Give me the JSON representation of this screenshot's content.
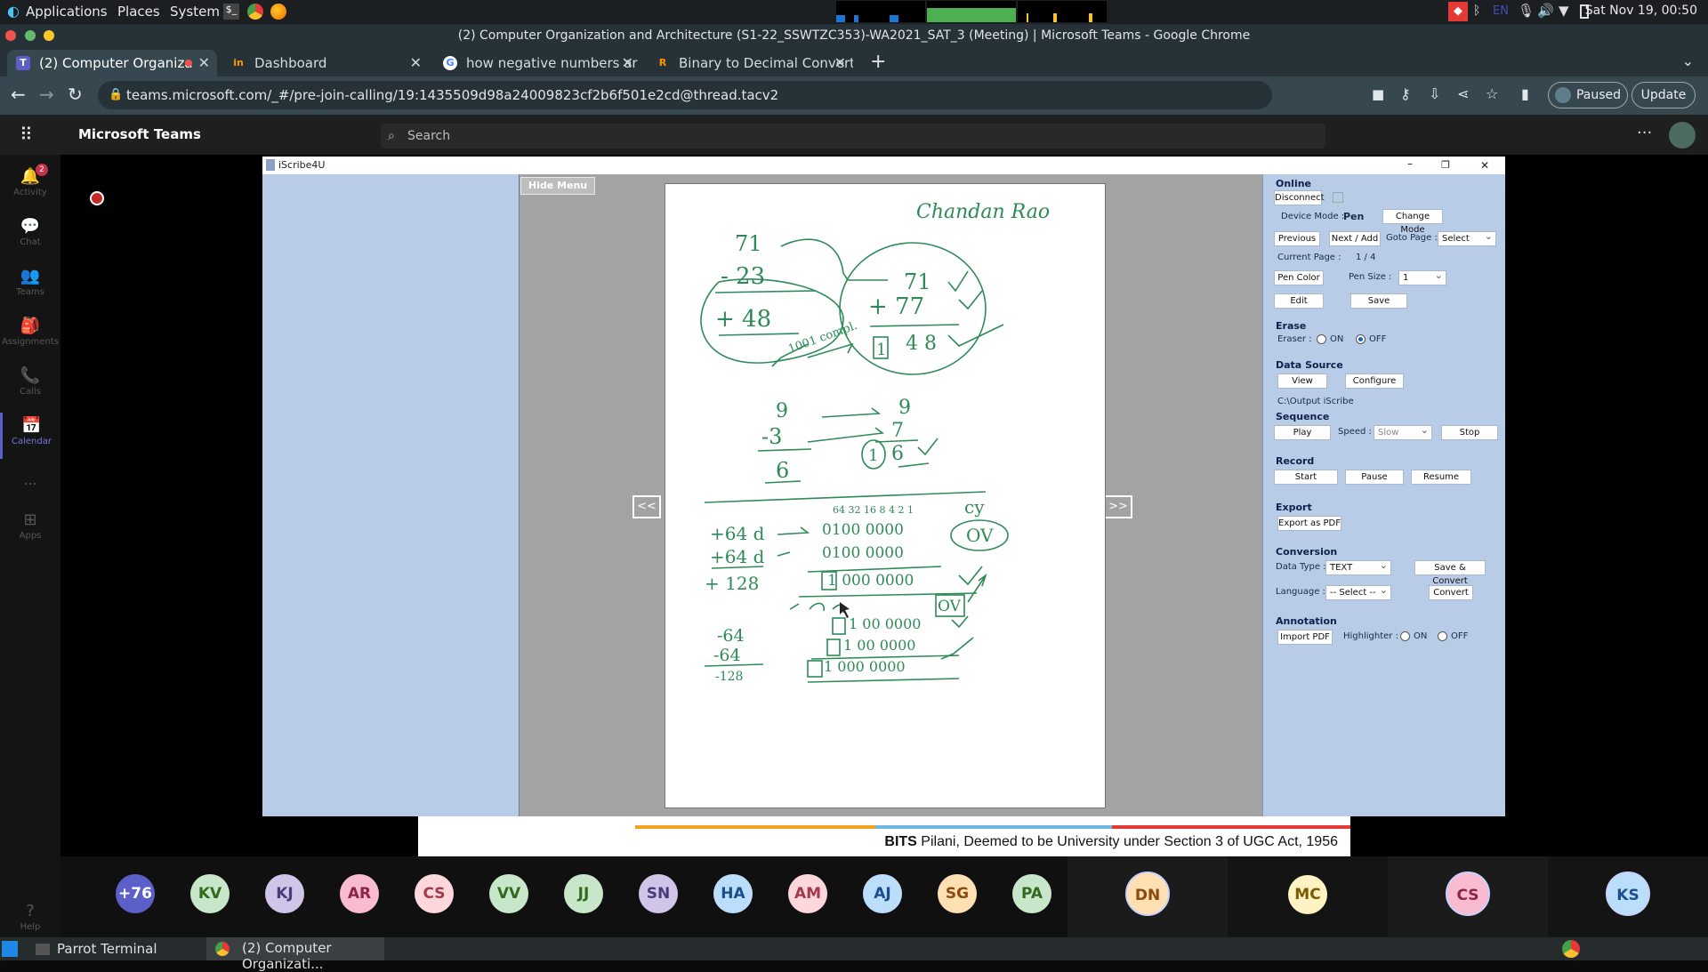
{
  "system_bar": {
    "menus": [
      "Applications",
      "Places",
      "System"
    ],
    "language": "EN",
    "clock": "Sat Nov 19, 00:50"
  },
  "window_title": "(2) Computer Organization and Architecture (S1-22_SSWTZC353)-WA2021_SAT_3 (Meeting) | Microsoft Teams - Google Chrome",
  "tabs": [
    {
      "label": "(2) Computer Organiza",
      "icon": "teams-icon"
    },
    {
      "label": "Dashboard",
      "icon": "dashboard-icon"
    },
    {
      "label": "how negative numbers ar",
      "icon": "google-icon"
    },
    {
      "label": "Binary to Decimal Convert",
      "icon": "rapidtables-icon"
    }
  ],
  "address_bar": {
    "url": "teams.microsoft.com/_#/pre-join-calling/19:1435509d98a24009823cf2b6f501e2cd@thread.tacv2",
    "profile_label": "Paused",
    "update_label": "Update"
  },
  "teams": {
    "brand": "Microsoft Teams",
    "search_placeholder": "Search",
    "rail": [
      {
        "label": "Activity",
        "icon": "bell-icon",
        "badge": "2"
      },
      {
        "label": "Chat",
        "icon": "chat-icon"
      },
      {
        "label": "Teams",
        "icon": "teams-icon"
      },
      {
        "label": "Assignments",
        "icon": "assignments-icon"
      },
      {
        "label": "Calls",
        "icon": "phone-icon"
      },
      {
        "label": "Calendar",
        "icon": "calendar-icon"
      },
      {
        "label": "...",
        "icon": "more-icon"
      },
      {
        "label": "Apps",
        "icon": "apps-icon"
      },
      {
        "label": "Help",
        "icon": "help-icon"
      }
    ]
  },
  "iscribe": {
    "title": "iScribe4U",
    "hide_menu": "Hide Menu",
    "prev_page": "<<",
    "next_page": ">>",
    "panel": {
      "online": "Online",
      "disconnect": "Disconnect",
      "device_mode_label": "Device Mode :",
      "device_mode_value": "Pen",
      "change_mode": "Change Mode",
      "previous": "Previous",
      "next_add": "Next / Add",
      "goto_page_label": "Goto Page :",
      "goto_page_value": "Select",
      "current_page_label": "Current Page :",
      "current_page_value": "1 / 4",
      "pen_color": "Pen Color",
      "pen_size_label": "Pen Size :",
      "pen_size_value": "1",
      "edit": "Edit",
      "save": "Save",
      "erase": "Erase",
      "eraser_label": "Eraser :",
      "eraser_on": "ON",
      "eraser_off": "OFF",
      "data_source": "Data Source",
      "view": "View",
      "configure": "Configure",
      "output_path": "C:\\Output iScribe",
      "sequence": "Sequence",
      "play": "Play",
      "speed_label": "Speed :",
      "speed_value": "Slow",
      "stop": "Stop",
      "record": "Record",
      "start": "Start",
      "pause": "Pause",
      "resume": "Resume",
      "export": "Export",
      "export_pdf": "Export as PDF",
      "conversion": "Conversion",
      "data_type_label": "Data Type :",
      "data_type_value": "TEXT",
      "save_convert": "Save & Convert",
      "language_label": "Language :",
      "language_value": "-- Select --",
      "convert": "Convert",
      "annotation": "Annotation",
      "import_pdf": "Import PDF",
      "highlighter_label": "Highlighter :",
      "highlighter_on": "ON",
      "highlighter_off": "OFF"
    },
    "handwriting": {
      "title": "Chandan Rao",
      "top_left": [
        "71",
        "- 23",
        "+ 48",
        "1001 compl."
      ],
      "top_right": [
        "71",
        "+ 77",
        "1",
        "4 8"
      ],
      "mid_left": [
        "9",
        "-3",
        "6"
      ],
      "mid_right": [
        "9",
        "7",
        "1",
        "6"
      ],
      "bits_header": "64 32 16 8 4 2 1",
      "rows_left": [
        "+64 d",
        "+64 d",
        "+ 128",
        "-64",
        "-64",
        "-128"
      ],
      "rows_right": [
        "0100 0000",
        "0100 0000",
        "1 000 0000",
        "1 00 0000",
        "1 00 0000",
        "1 000 0000"
      ],
      "cy": "cy",
      "ov": "OV"
    }
  },
  "caption": {
    "bold": "BITS",
    "text": " Pilani, Deemed to be University under Section 3 of UGC Act, 1956"
  },
  "participants": [
    "+76",
    "KV",
    "KJ",
    "AR",
    "CS",
    "VV",
    "JJ",
    "SN",
    "HA",
    "AM",
    "AJ",
    "SG",
    "PA",
    "DN",
    "MC",
    "CS",
    "KS"
  ],
  "taskbar": {
    "items": [
      "Parrot Terminal",
      "(2) Computer Organizati..."
    ]
  },
  "colors": {
    "teams_accent": "#5b5fc7",
    "chrome_dark": "#263238",
    "ink": "#2e8b57"
  }
}
